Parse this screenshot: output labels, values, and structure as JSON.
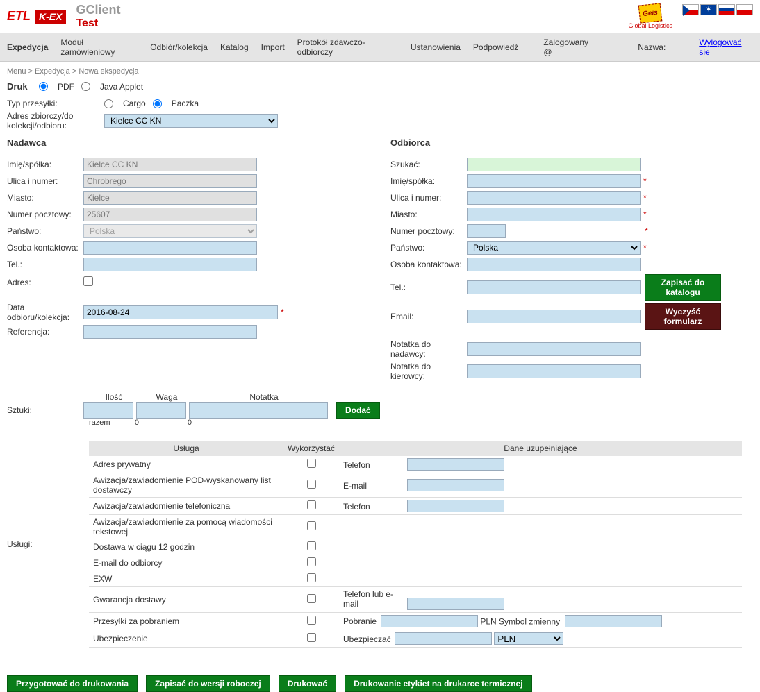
{
  "header": {
    "logo1": "ETL",
    "logo2": "K-EX",
    "app_name": "GClient",
    "env": "Test",
    "geis": "Geis",
    "geis_sub": "Global Logistics"
  },
  "nav": {
    "items": [
      "Expedycja",
      "Moduł zamówieniowy",
      "Odbiór/kolekcja",
      "Katalog",
      "Import",
      "Protokół zdawczo-odbiorczy",
      "Ustanowienia",
      "Podpowiedź"
    ],
    "logged_label": "Zalogowany @",
    "name_label": "Nazwa:",
    "logout": "Wylogować sie"
  },
  "breadcrumb": "Menu > Expedycja > Nowa ekspedycja",
  "print": {
    "title": "Druk",
    "options": [
      "PDF",
      "Java Applet"
    ]
  },
  "ship_type": {
    "label": "Typ przesyłki:",
    "options": [
      "Cargo",
      "Paczka"
    ]
  },
  "bulk_addr": {
    "label": "Adres zbiorczy/do kolekcji/odbioru:",
    "value": "Kielce CC KN"
  },
  "sender": {
    "title": "Nadawca",
    "name_label": "Imię/spółka:",
    "name": "Kielce CC KN",
    "street_label": "Ulica i numer:",
    "street": "Chrobrego",
    "city_label": "Miasto:",
    "city": "Kielce",
    "zip_label": "Numer pocztowy:",
    "zip": "25607",
    "country_label": "Państwo:",
    "country": "Polska",
    "contact_label": "Osoba kontaktowa:",
    "tel_label": "Tel.:",
    "addr_label": "Adres:",
    "date_label": "Data odbioru/kolekcja:",
    "date": "2016-08-24",
    "ref_label": "Referencja:"
  },
  "recipient": {
    "title": "Odbiorca",
    "search_label": "Szukać:",
    "name_label": "Imię/spółka:",
    "street_label": "Ulica i numer:",
    "city_label": "Miasto:",
    "zip_label": "Numer pocztowy:",
    "country_label": "Państwo:",
    "country": "Polska",
    "contact_label": "Osoba kontaktowa:",
    "tel_label": "Tel.:",
    "email_label": "Email:",
    "note_sender_label": "Notatka do nadawcy:",
    "note_driver_label": "Notatka do kierowcy:",
    "save_btn": "Zapisać do katalogu",
    "clear_btn": "Wyczyść formularz"
  },
  "pieces": {
    "label": "Sztuki:",
    "cols": [
      "Ilość",
      "Waga",
      "Notatka"
    ],
    "add_btn": "Dodać",
    "total_label": "razem",
    "total_qty": "0",
    "total_weight": "0"
  },
  "services": {
    "label": "Usługi:",
    "headers": [
      "Usługa",
      "Wykorzystać",
      "Dane uzupełniające"
    ],
    "rows": [
      {
        "name": "Adres prywatny",
        "supp_label": "Telefon"
      },
      {
        "name": "Awizacja/zawiadomienie POD-wyskanowany list dostawczy",
        "supp_label": "E-mail"
      },
      {
        "name": "Awizacja/zawiadomienie telefoniczna",
        "supp_label": "Telefon"
      },
      {
        "name": "Awizacja/zawiadomienie za pomocą wiadomości tekstowej",
        "supp_label": ""
      },
      {
        "name": "Dostawa w ciągu 12 godzin",
        "supp_label": ""
      },
      {
        "name": "E-mail do odbiorcy",
        "supp_label": ""
      },
      {
        "name": "EXW",
        "supp_label": ""
      },
      {
        "name": "Gwarancja dostawy",
        "supp_label": "Telefon lub e-mail"
      },
      {
        "name": "Przesyłki za pobraniem",
        "supp_cod": true,
        "cod_label": "Pobranie",
        "cod_curr": "PLN",
        "cod_vs": "Symbol zmienny"
      },
      {
        "name": "Ubezpieczenie",
        "supp_ins": true,
        "ins_label": "Ubezpieczać",
        "ins_curr": "PLN"
      }
    ]
  },
  "footer": {
    "btn1": "Przygotować do drukowania",
    "btn2": "Zapisać do wersji roboczej",
    "btn3": "Drukować",
    "btn4": "Drukowanie etykiet na drukarce termicznej"
  }
}
